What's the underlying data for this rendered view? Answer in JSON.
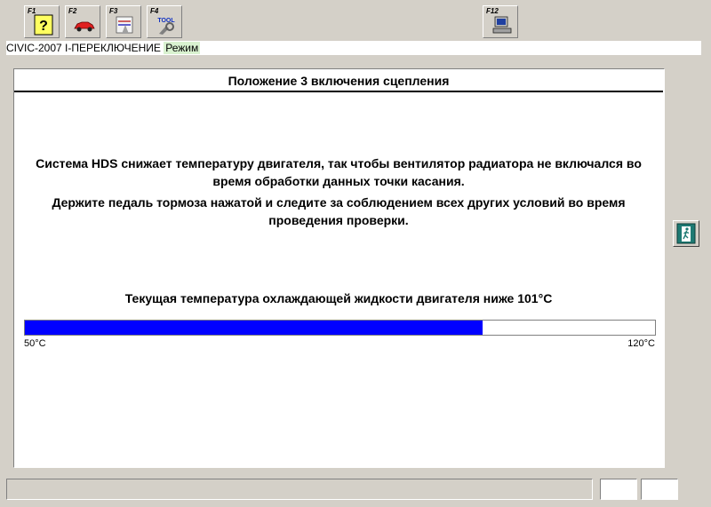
{
  "toolbar": {
    "buttons": [
      {
        "key": "F1",
        "icon": "help-icon"
      },
      {
        "key": "F2",
        "icon": "car-icon"
      },
      {
        "key": "F3",
        "icon": "data-icon"
      },
      {
        "key": "F4",
        "icon": "tool-icon"
      },
      {
        "key": "F12",
        "icon": "computer-icon"
      }
    ],
    "f4_icon_text": "TOOL"
  },
  "menubar": {
    "vehicle": "CIVIC-2007",
    "function": "I-ПЕРЕКЛЮЧЕНИЕ",
    "mode": "Режим"
  },
  "main": {
    "title": "Положение 3 включения сцепления",
    "paragraph1": "Система HDS снижает температуру двигателя, так чтобы вентилятор радиатора не включался во время обработки данных точки касания.",
    "paragraph2": "Держите педаль тормоза нажатой и следите за соблюдением всех других условий во время проведения проверки.",
    "bar_label": "Текущая температура охлаждающей жидкости двигателя ниже 101°C",
    "bar_min_label": "50°C",
    "bar_max_label": "120°C",
    "bar_fill_fraction": 0.727
  },
  "exit_button": {
    "icon": "exit-door-icon"
  },
  "colors": {
    "bar_fill": "#0000ff",
    "mode_bg": "#d9f2d0"
  }
}
